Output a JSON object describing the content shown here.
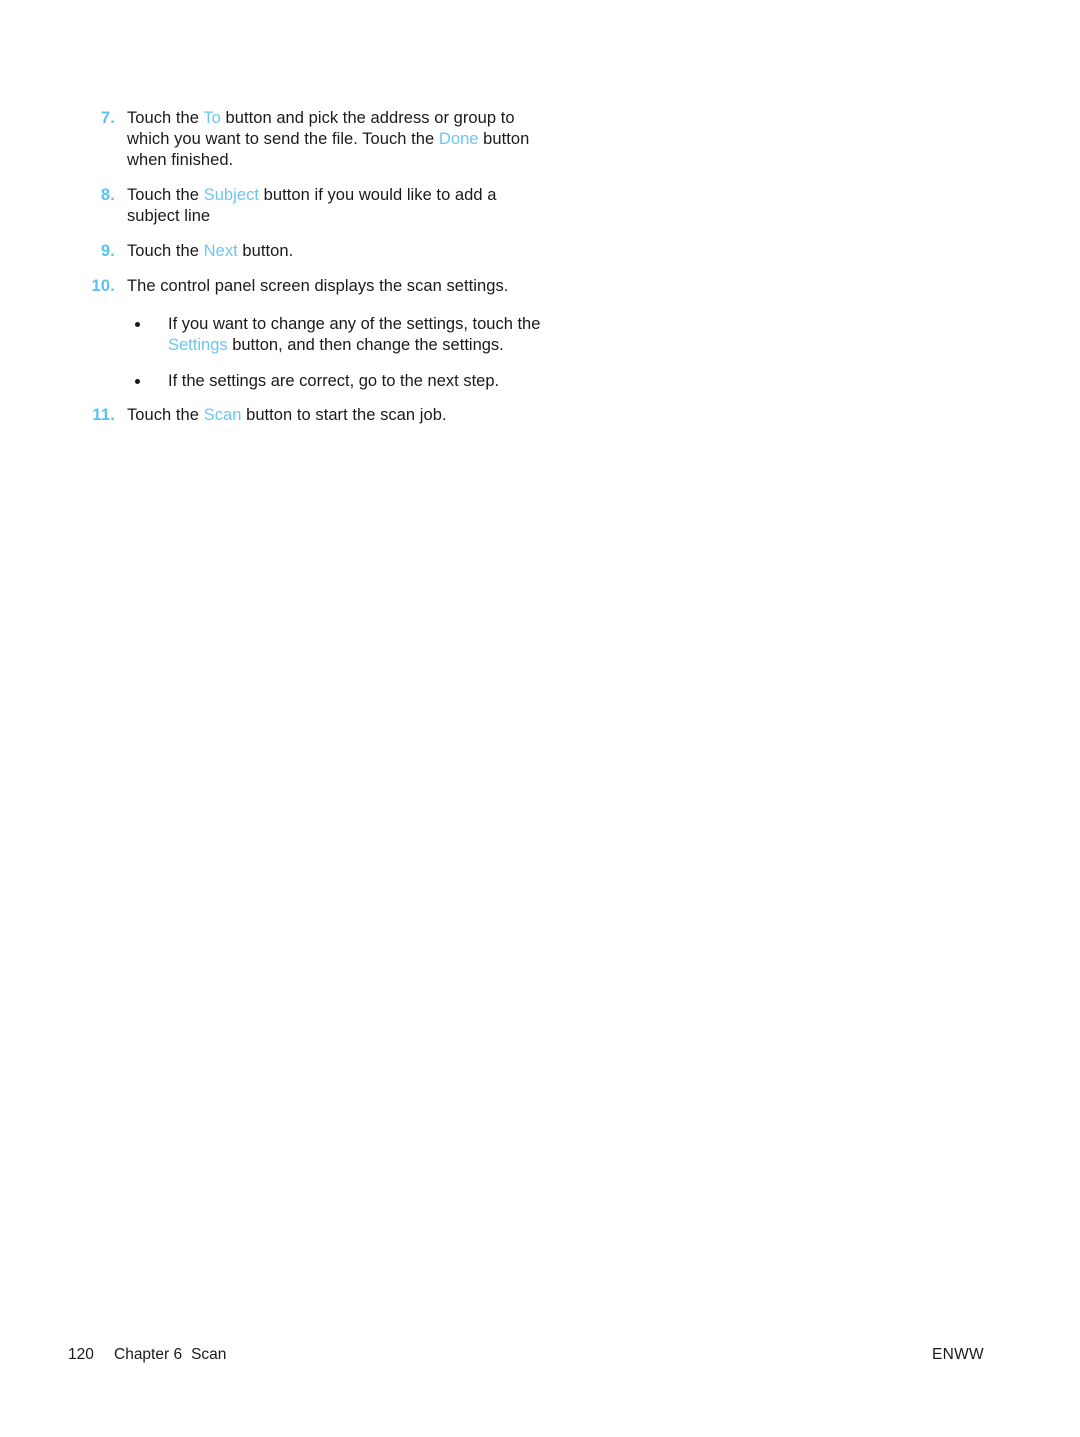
{
  "document": {
    "type": "user-guide-page",
    "background_color": "#ffffff",
    "text_color": "#1a1a1a",
    "accent_color": "#6BC7F2"
  },
  "procedure": {
    "steps": [
      {
        "number": "7.",
        "segments": [
          {
            "text": "Touch the ",
            "style": "plain"
          },
          {
            "text": "To",
            "style": "ui"
          },
          {
            "text": " button and pick the address or group to which you want to send the file. Touch the ",
            "style": "plain"
          },
          {
            "text": "Done",
            "style": "ui"
          },
          {
            "text": " button when finished.",
            "style": "plain"
          }
        ]
      },
      {
        "number": "8.",
        "segments": [
          {
            "text": "Touch the ",
            "style": "plain"
          },
          {
            "text": "Subject",
            "style": "ui"
          },
          {
            "text": " button if you would like to add a subject line",
            "style": "plain"
          }
        ]
      },
      {
        "number": "9.",
        "segments": [
          {
            "text": "Touch the ",
            "style": "plain"
          },
          {
            "text": "Next",
            "style": "ui"
          },
          {
            "text": " button.",
            "style": "plain"
          }
        ]
      },
      {
        "number": "10.",
        "segments": [
          {
            "text": "The control panel screen displays the scan settings.",
            "style": "plain"
          }
        ],
        "bullets": [
          {
            "segments": [
              {
                "text": "If you want to change any of the settings, touch the ",
                "style": "plain"
              },
              {
                "text": "Settings",
                "style": "ui"
              },
              {
                "text": " button, and then change the settings.",
                "style": "plain"
              }
            ]
          },
          {
            "segments": [
              {
                "text": "If the settings are correct, go to the next step.",
                "style": "plain"
              }
            ]
          }
        ]
      },
      {
        "number": "11.",
        "segments": [
          {
            "text": "Touch the ",
            "style": "plain"
          },
          {
            "text": "Scan",
            "style": "ui"
          },
          {
            "text": " button to start the scan job.",
            "style": "plain"
          }
        ]
      }
    ]
  },
  "footer": {
    "page_number": "120",
    "chapter_label": "Chapter 6",
    "section_label": "Scan",
    "locale_code": "ENWW"
  }
}
